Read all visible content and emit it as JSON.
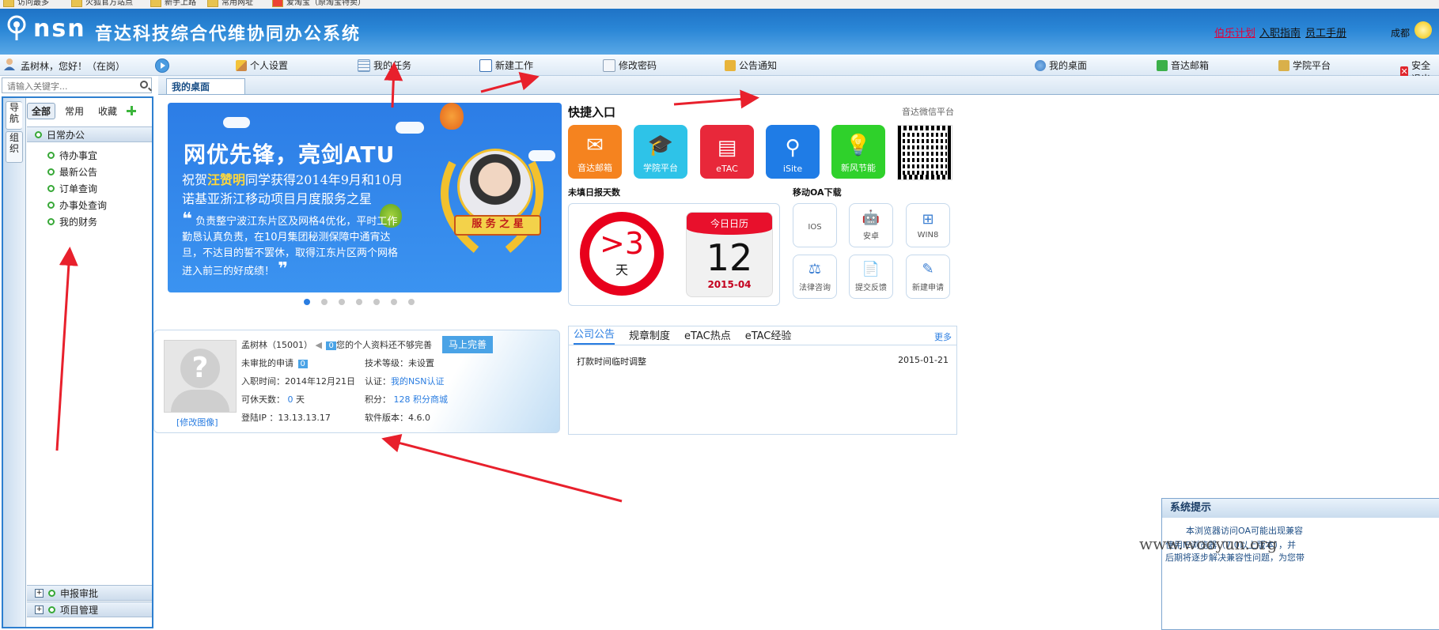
{
  "bookmarks": [
    "访问最多",
    "火狐官方站点",
    "新手上路",
    "常用网址",
    "爱淘宝（原淘宝特卖）"
  ],
  "header": {
    "logo_text": "nsn",
    "system_title": "音达科技综合代维协同办公系统",
    "links": [
      "伯乐计划",
      "入职指南",
      "员工手册"
    ],
    "city": "成都"
  },
  "menubar": {
    "greeting": "孟树林，您好！（在岗）",
    "left_items": [
      {
        "label": "个人设置",
        "icon": "pencil-icon"
      },
      {
        "label": "我的任务",
        "icon": "table-icon"
      },
      {
        "label": "新建工作",
        "icon": "edit-icon"
      },
      {
        "label": "修改密码",
        "icon": "document-icon"
      },
      {
        "label": "公告通知",
        "icon": "briefcase-icon"
      }
    ],
    "right_items": [
      {
        "label": "我的桌面",
        "icon": "gear-icon"
      },
      {
        "label": "音达邮箱",
        "icon": "mail-icon"
      },
      {
        "label": "学院平台",
        "icon": "speaker-icon"
      },
      {
        "label": "安全退出",
        "icon": "close-icon"
      }
    ]
  },
  "sidebar": {
    "search_placeholder": "请输入关键字...",
    "vtabs": [
      "导航",
      "组织"
    ],
    "filters": [
      "全部",
      "常用",
      "收藏"
    ],
    "active_group": "日常办公",
    "items": [
      "待办事宜",
      "最新公告",
      "订单查询",
      "办事处查询",
      "我的财务"
    ],
    "bottom_groups": [
      "申报审批",
      "项目管理"
    ]
  },
  "content": {
    "tab_label": "我的桌面"
  },
  "banner": {
    "title": "网优先锋，亮剑ATU",
    "line1_pre": "祝贺",
    "line1_name": "汪赞明",
    "line1_post": "同学获得2014年9月和10月",
    "line2": "诺基亚浙江移动项目月度服务之星",
    "quote": "负责整宁波江东片区及网格4优化，平时工作勤恳认真负责，在10月集团秘测保障中通宵达旦，不达目的誓不罢休，取得江东片区两个网格进入前三的好成绩！",
    "ribbon": "服 务 之 星",
    "slides": 7,
    "active_slide": 0
  },
  "quick": {
    "title": "快捷入口",
    "wechat": "音达微信平台",
    "tiles": [
      {
        "label": "音达邮箱",
        "icon": "envelope-icon",
        "color": "#f5831f"
      },
      {
        "label": "学院平台",
        "icon": "graduation-cap-icon",
        "color": "#2ec3e8"
      },
      {
        "label": "eTAC",
        "icon": "calendar-icon",
        "color": "#e8283a"
      },
      {
        "label": "iSite",
        "icon": "location-pin-icon",
        "color": "#1f7ce6"
      },
      {
        "label": "新风节能",
        "icon": "bulb-icon",
        "color": "#2fd12b"
      }
    ]
  },
  "report": {
    "title": "未填日报天数",
    "days": ">3",
    "unit": "天",
    "calendar_head": "今日日历",
    "day": "12",
    "month": "2015-04"
  },
  "mobile": {
    "title": "移动OA下载",
    "tiles": [
      {
        "label": "IOS",
        "icon": "apple-icon"
      },
      {
        "label": "安卓",
        "icon": "android-icon"
      },
      {
        "label": "WIN8",
        "icon": "windows-icon"
      },
      {
        "label": "法律咨询",
        "icon": "gavel-icon"
      },
      {
        "label": "提交反馈",
        "icon": "feedback-icon"
      },
      {
        "label": "新建申请",
        "icon": "new-request-icon"
      }
    ]
  },
  "profile": {
    "name_id": "孟树林（15001）",
    "msg_count": "0",
    "incomplete_text": "您的个人资料还不够完善",
    "complete_btn": "马上完善",
    "edit_avatar": "[修改图像]",
    "pending_label": "未审批的申请",
    "pending_count": "0",
    "tech_level": "技术等级：未设置",
    "join_date": "入职时间：2014年12月21日",
    "cert_label": "认证：",
    "cert_link": "我的NSN认证",
    "leave_label": "可休天数：",
    "leave_days": "0",
    "leave_unit": "天",
    "points_label": "积分：",
    "points": "128",
    "points_link": "积分商城",
    "login_ip": "登陆IP ：13.13.13.17",
    "software_ver": "软件版本：4.6.0"
  },
  "notices": {
    "tabs": [
      "公司公告",
      "规章制度",
      "eTAC热点",
      "eTAC经验"
    ],
    "more": "更多",
    "rows": [
      {
        "title": "打款时间临时调整",
        "date": "2015-01-21"
      }
    ]
  },
  "sys_tip": {
    "title": "系统提示",
    "line1": "本浏览器访问OA可能出现兼容",
    "line2": "使用IE浏览器（7.0以上版本），并",
    "line3": "后期将逐步解决兼容性问题，为您带"
  },
  "watermark": "www.wooyun.org"
}
